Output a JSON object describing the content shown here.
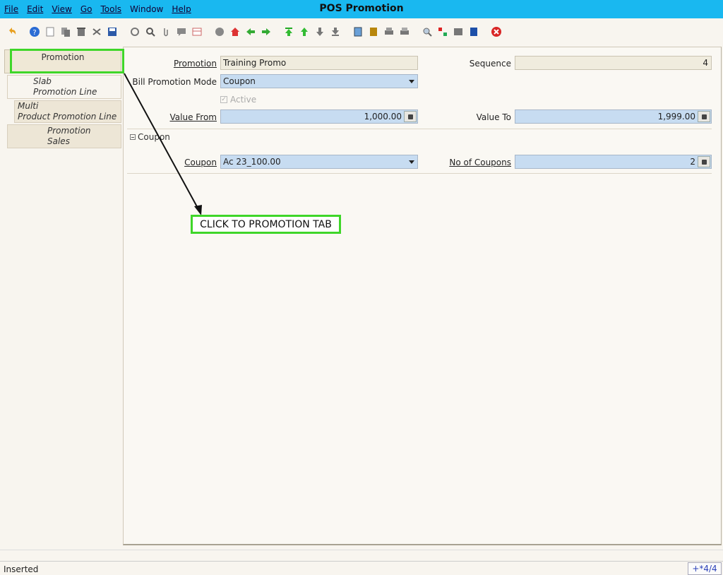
{
  "window": {
    "title": "POS Promotion"
  },
  "menu": [
    {
      "label": "File"
    },
    {
      "label": "Edit"
    },
    {
      "label": "View"
    },
    {
      "label": "Go"
    },
    {
      "label": "Tools"
    },
    {
      "label": "Window"
    },
    {
      "label": "Help"
    }
  ],
  "toolbar_icons": [
    "undo-icon",
    "help-icon",
    "new-record-icon",
    "copy-record-icon",
    "delete-icon",
    "delete-selection-icon",
    "save-icon",
    "refresh-icon",
    "find-icon",
    "attachment-icon",
    "chat-icon",
    "grid-toggle-icon",
    "history-icon",
    "home-icon",
    "back-icon",
    "forward-icon",
    "first-record-icon",
    "previous-record-icon",
    "next-record-icon",
    "last-record-icon",
    "report-icon",
    "archive-icon",
    "print-preview-icon",
    "print-icon",
    "zoom-across-icon",
    "workflow-icon",
    "request-icon",
    "product-info-icon",
    "exit-icon"
  ],
  "tabs": [
    {
      "label": "Promotion",
      "selected": true
    },
    {
      "label_line1": "Slab",
      "label_line2": "Promotion Line"
    },
    {
      "label_line1": "Multi",
      "label_line2": "Product Promotion Line"
    },
    {
      "label_line1": "Promotion",
      "label_line2": "Sales"
    }
  ],
  "form": {
    "promotion_label": "Promotion",
    "promotion_value": "Training Promo",
    "sequence_label": "Sequence",
    "sequence_value": "4",
    "bill_mode_label": "Bill Promotion Mode",
    "bill_mode_value": "Coupon",
    "active_label": "Active",
    "active_checked": true,
    "value_from_label": "Value From",
    "value_from": "1,000.00",
    "value_to_label": "Value To",
    "value_to": "1,999.00"
  },
  "coupon_section": {
    "title": "Coupon",
    "coupon_label": "Coupon",
    "coupon_value": "Ac 23_100.00",
    "no_of_coupons_label": "No of Coupons",
    "no_of_coupons": "2"
  },
  "annotation": {
    "callout_text": "CLICK TO PROMOTION TAB",
    "color": "#3fd629"
  },
  "status": {
    "text": "Inserted",
    "record_count": "+*4/4"
  },
  "colors": {
    "menubar": "#19b8f0",
    "field_bg": "#c7dcf1",
    "readonly_bg": "#f0ecde"
  }
}
